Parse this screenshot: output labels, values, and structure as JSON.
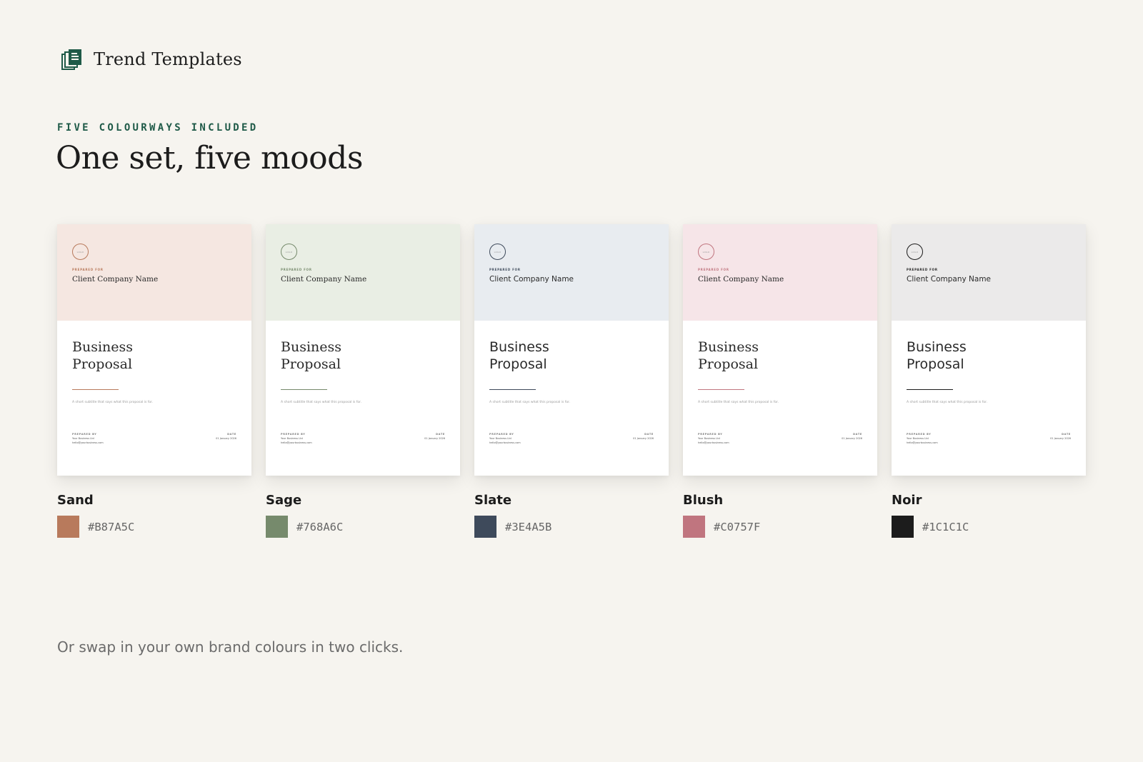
{
  "brand": {
    "name": "Trend Templates",
    "icon": "document-stack-icon",
    "color": "#1f5a48"
  },
  "eyebrow": "FIVE COLOURWAYS INCLUDED",
  "headline": "One set, five moods",
  "card_text": {
    "logo": "LOGO",
    "prepared_for": "PREPARED FOR",
    "client": "Client Company Name",
    "title_line1": "Business",
    "title_line2": "Proposal",
    "subtitle": "A short subtitle that says what this proposal is for.",
    "prepared_by": "PREPARED BY",
    "business": "Your Business Ltd",
    "email": "hello@yourbusiness.com",
    "date_label": "DATE",
    "date": "01 January 2026"
  },
  "colourways": [
    {
      "name": "Sand",
      "hex": "#B87A5C",
      "tint": "#f5e7e1",
      "serif": true
    },
    {
      "name": "Sage",
      "hex": "#768A6C",
      "tint": "#e9eee4",
      "serif": true
    },
    {
      "name": "Slate",
      "hex": "#3E4A5B",
      "tint": "#e8ecf0",
      "serif": false
    },
    {
      "name": "Blush",
      "hex": "#C0757F",
      "tint": "#f6e5e8",
      "serif": true
    },
    {
      "name": "Noir",
      "hex": "#1C1C1C",
      "tint": "#ebeaea",
      "serif": false
    }
  ],
  "footnote": "Or swap in your own brand colours in two clicks."
}
